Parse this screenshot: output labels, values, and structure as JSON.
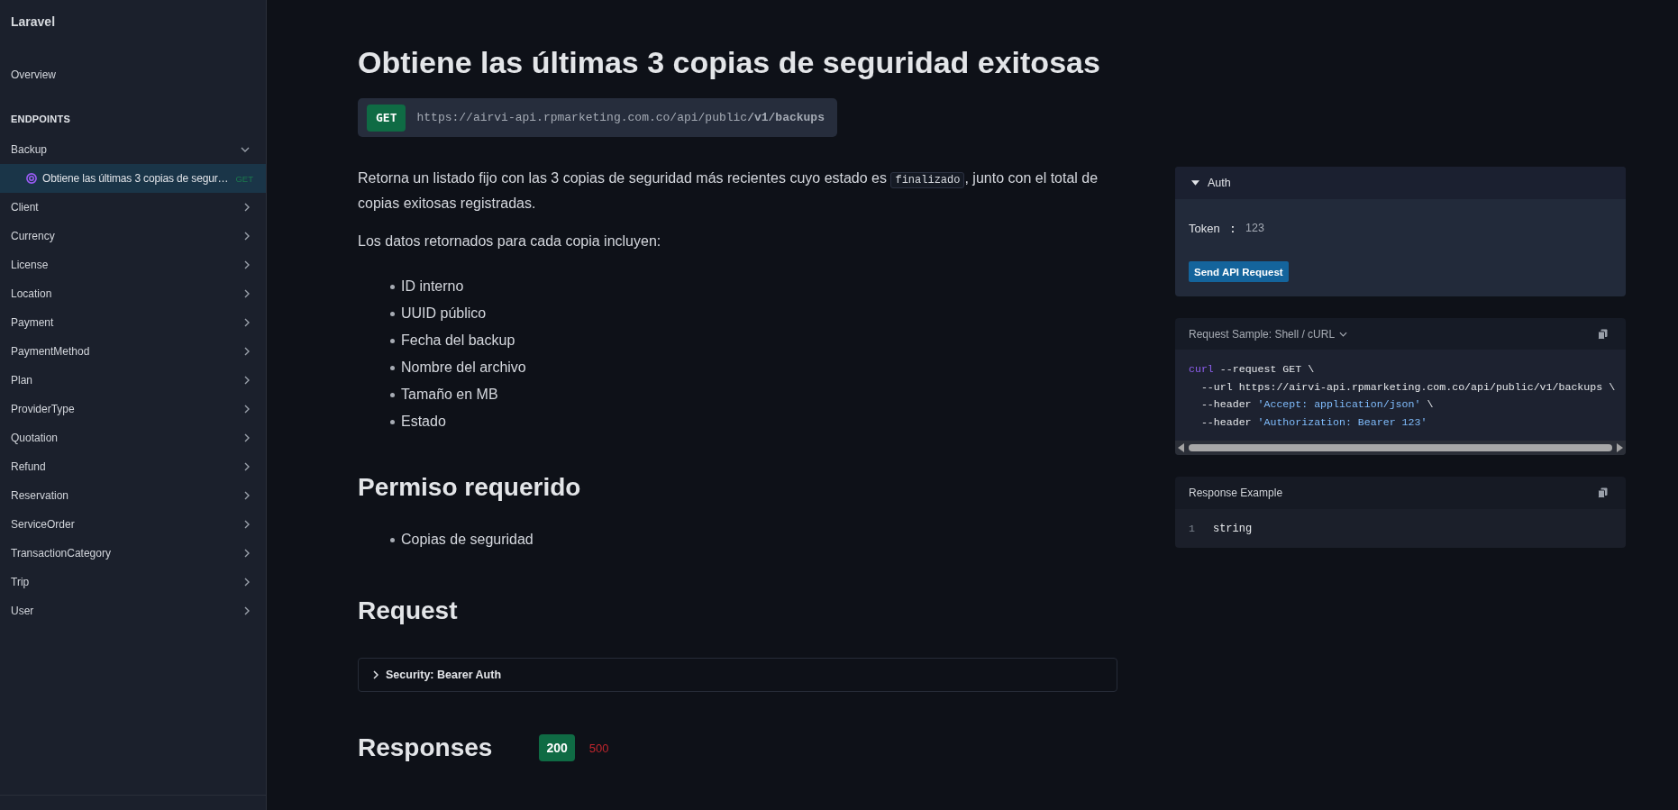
{
  "sidebar": {
    "title": "Laravel",
    "overview": "Overview",
    "section": "ENDPOINTS",
    "groups": [
      {
        "label": "Backup",
        "expanded": true,
        "children": [
          {
            "label": "Obtiene las últimas 3 copias de segur…",
            "method": "GET",
            "selected": true
          }
        ]
      },
      {
        "label": "Client",
        "expanded": false
      },
      {
        "label": "Currency",
        "expanded": false
      },
      {
        "label": "License",
        "expanded": false
      },
      {
        "label": "Location",
        "expanded": false
      },
      {
        "label": "Payment",
        "expanded": false
      },
      {
        "label": "PaymentMethod",
        "expanded": false
      },
      {
        "label": "Plan",
        "expanded": false
      },
      {
        "label": "ProviderType",
        "expanded": false
      },
      {
        "label": "Quotation",
        "expanded": false
      },
      {
        "label": "Refund",
        "expanded": false
      },
      {
        "label": "Reservation",
        "expanded": false
      },
      {
        "label": "ServiceOrder",
        "expanded": false
      },
      {
        "label": "TransactionCategory",
        "expanded": false
      },
      {
        "label": "Trip",
        "expanded": false
      },
      {
        "label": "User",
        "expanded": false
      }
    ]
  },
  "endpoint": {
    "title": "Obtiene las últimas 3 copias de seguridad exitosas",
    "method": "GET",
    "url": "https://airvi-api.rpmarketing.com.co/api/public**/v1/backups**",
    "description": [
      {
        "kind": "text",
        "text": "Retorna un listado fijo con las 3 copias de seguridad más recientes cuyo estado es "
      },
      {
        "kind": "code",
        "text": "finalizado"
      },
      {
        "kind": "text",
        "text": ", junto con el total de copias exitosas registradas."
      }
    ],
    "list_intro": "Los datos retornados para cada copia incluyen:",
    "fields": [
      "ID interno",
      "UUID público",
      "Fecha del backup",
      "Nombre del archivo",
      "Tamaño en MB",
      "Estado"
    ]
  },
  "permission": {
    "heading": "Permiso requerido",
    "items": [
      "Copias de seguridad"
    ]
  },
  "request": {
    "heading": "Request",
    "security": {
      "label": "Security: Bearer Auth",
      "expanded": false
    }
  },
  "responses": {
    "heading": "Responses",
    "tabs": [
      {
        "code": "200",
        "color": "#0f6b44",
        "selected": true
      },
      {
        "code": "500",
        "color": "#c0262d",
        "selected": false
      }
    ]
  },
  "auth": {
    "title": "Auth",
    "expanded": true,
    "fields": [
      {
        "label": "Token",
        "separator": ":",
        "value": "123"
      }
    ],
    "button": "Send API Request"
  },
  "request_sample": {
    "title": "Request Sample: Shell / cURL",
    "lines": [
      [
        {
          "kind": "keyword",
          "text": "curl"
        },
        {
          "kind": "plain",
          "text": " --request GET \\"
        }
      ],
      [
        {
          "kind": "plain",
          "text": "  --url https://airvi-api.rpmarketing.com.co/api/public/v1/backups \\"
        }
      ],
      [
        {
          "kind": "plain",
          "text": "  --header "
        },
        {
          "kind": "string",
          "text": "'Accept: application/json'"
        },
        {
          "kind": "plain",
          "text": " \\"
        }
      ],
      [
        {
          "kind": "plain",
          "text": "  --header "
        },
        {
          "kind": "string",
          "text": "'Authorization: Bearer 123'"
        }
      ]
    ]
  },
  "response_example": {
    "title": "Response Example",
    "lines": [
      {
        "number": "1",
        "text": "string"
      }
    ]
  }
}
